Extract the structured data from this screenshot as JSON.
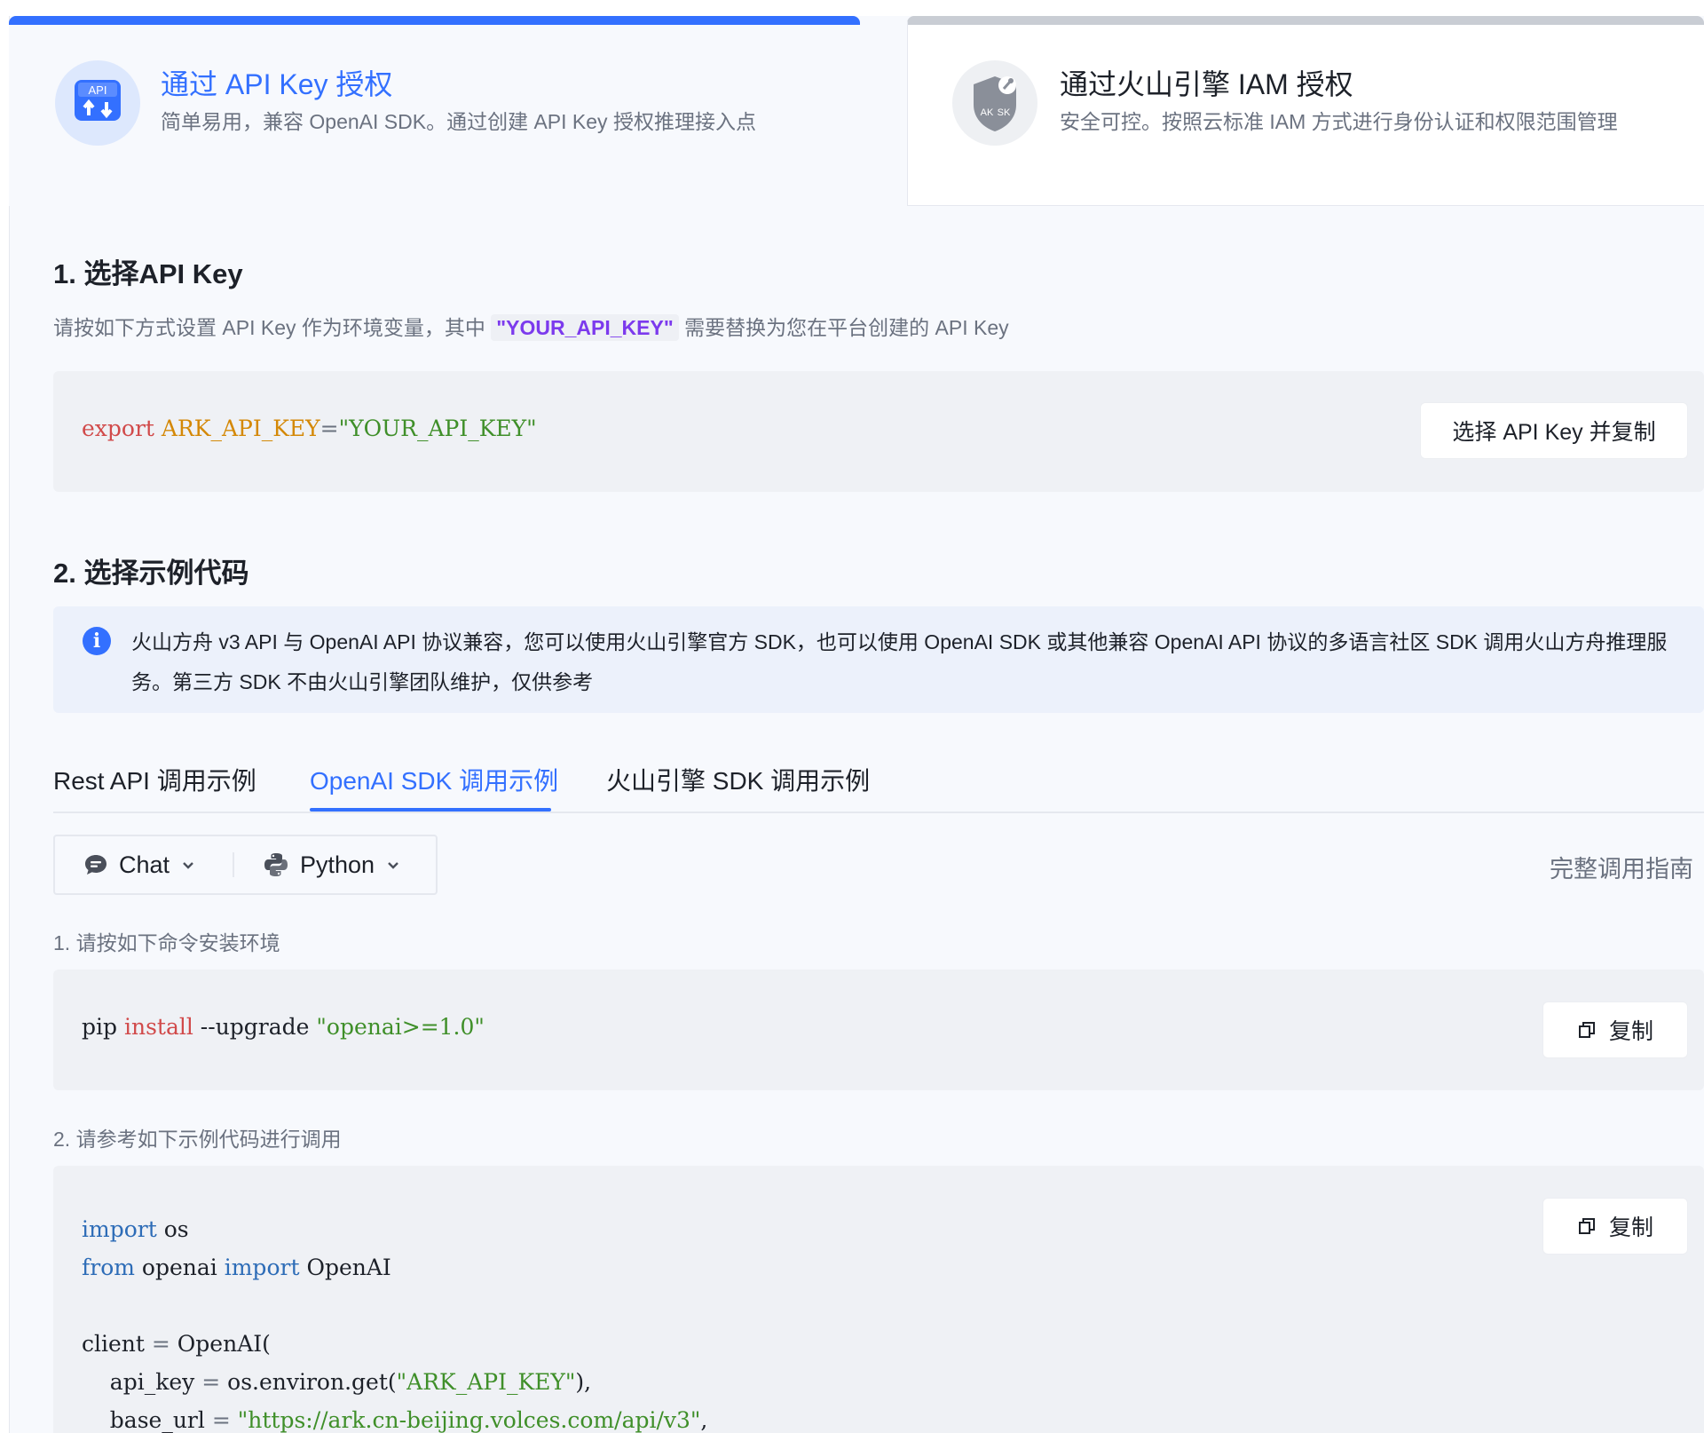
{
  "auth_tabs": {
    "api_key": {
      "title": "通过 API Key 授权",
      "desc": "简单易用，兼容 OpenAI SDK。通过创建 API Key 授权推理接入点",
      "icon_label": "API"
    },
    "iam": {
      "title": "通过火山引擎 IAM 授权",
      "desc": "安全可控。按照云标准 IAM 方式进行身份认证和权限范围管理",
      "icon_labels": [
        "AK",
        "SK"
      ]
    }
  },
  "section1": {
    "heading": "1. 选择API Key",
    "desc_prefix": "请按如下方式设置 API Key 作为环境变量，其中",
    "desc_highlight": "\"YOUR_API_KEY\"",
    "desc_suffix": "需要替换为您在平台创建的 API Key",
    "code": {
      "kw_export": "export",
      "var_name": "ARK_API_KEY",
      "eq": "=",
      "value": "\"YOUR_API_KEY\""
    },
    "button_label": "选择 API Key 并复制"
  },
  "section2": {
    "heading": "2. 选择示例代码",
    "alert_text": "火山方舟 v3 API 与 OpenAI API 协议兼容，您可以使用火山引擎官方 SDK，也可以使用 OpenAI SDK 或其他兼容 OpenAI API 协议的多语言社区 SDK 调用火山方舟推理服务。第三方 SDK 不由火山引擎团队维护，仅供参考",
    "tabs": [
      "Rest API 调用示例",
      "OpenAI SDK 调用示例",
      "火山引擎 SDK 调用示例"
    ],
    "active_tab": 1,
    "selectors": {
      "mode": "Chat",
      "language": "Python"
    },
    "guide_link": "完整调用指南",
    "step1_label": "1. 请按如下命令安装环境",
    "install_code": {
      "cmd": "pip",
      "sub": "install",
      "flag": "--upgrade",
      "pkg": "\"openai>=1.0\""
    },
    "copy_label": "复制",
    "step2_label": "2. 请参考如下示例代码进行调用",
    "sample_code": {
      "l1_kw": "import",
      "l1_rest": "os",
      "l2_kw1": "from",
      "l2_mod": "openai",
      "l2_kw2": "import",
      "l2_cls": "OpenAI",
      "l4_var": "client",
      "l4_eq": "=",
      "l4_call": "OpenAI(",
      "l5_key": "api_key",
      "l5_eq": "=",
      "l5_call": "os.environ.get(",
      "l5_str": "\"ARK_API_KEY\"",
      "l5_end": "),",
      "l6_key": "base_url",
      "l6_eq": "=",
      "l6_str": "\"https://ark.cn-beijing.volces.com/api/v3\"",
      "l6_end": ","
    }
  },
  "colors": {
    "accent": "#3370ff",
    "panel_bg": "#f7f9fd",
    "code_bg": "#eff1f5"
  }
}
